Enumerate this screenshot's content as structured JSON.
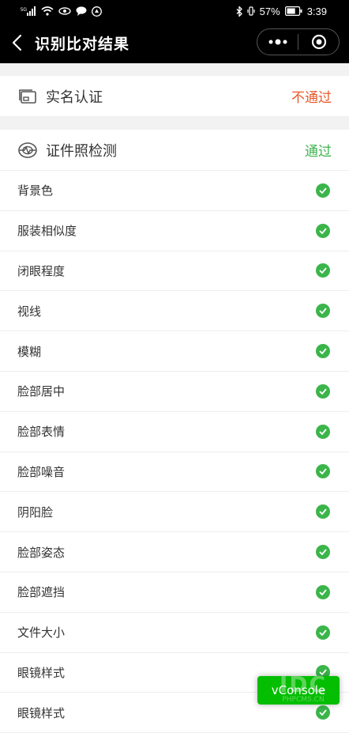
{
  "status_bar": {
    "network": "5G",
    "battery": "57%",
    "time": "3:39"
  },
  "nav": {
    "title": "识别比对结果"
  },
  "realname": {
    "title": "实名认证",
    "status": "不通过"
  },
  "photo_check": {
    "title": "证件照检测",
    "status": "通过",
    "items": [
      {
        "label": "背景色"
      },
      {
        "label": "服装相似度"
      },
      {
        "label": "闭眼程度"
      },
      {
        "label": "视线"
      },
      {
        "label": "模糊"
      },
      {
        "label": "脸部居中"
      },
      {
        "label": "脸部表情"
      },
      {
        "label": "脸部噪音"
      },
      {
        "label": "阴阳脸"
      },
      {
        "label": "脸部姿态"
      },
      {
        "label": "脸部遮挡"
      },
      {
        "label": "文件大小"
      },
      {
        "label": "眼镜样式"
      },
      {
        "label": "眼镜样式"
      }
    ]
  },
  "vconsole": {
    "label": "vConsole"
  },
  "watermark": {
    "letters": "IDC",
    "caption": "PHPCMS.CN"
  },
  "colors": {
    "fail": "#e9582a",
    "pass": "#3fb34f",
    "vconsole": "#04be02"
  }
}
